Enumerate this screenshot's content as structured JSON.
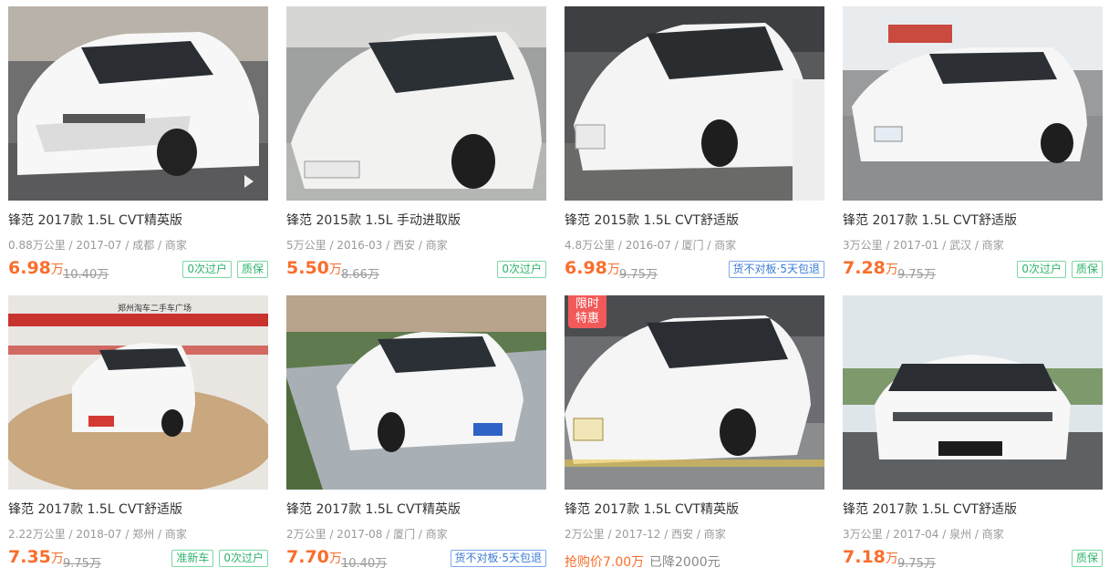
{
  "cards": [
    {
      "title": "锋范 2017款 1.5L CVT精英版",
      "meta": "0.88万公里 / 2017-07 / 成都 / 商家",
      "price": "6.98",
      "unit": "万",
      "orig": "10.40万",
      "tags": [
        "0次过户",
        "质保"
      ],
      "photo": {
        "bg": "#6f6f70",
        "floor": "#5a5a5c",
        "top": "#b9b2a8"
      }
    },
    {
      "title": "锋范 2015款 1.5L 手动进取版",
      "meta": "5万公里 / 2016-03 / 西安 / 商家",
      "price": "5.50",
      "unit": "万",
      "orig": "8.66万",
      "tags": [
        "0次过户"
      ],
      "photo": {
        "bg": "#9fa1a0",
        "floor": "#b4b6b4",
        "top": "#d6d6d2"
      }
    },
    {
      "title": "锋范 2015款 1.5L CVT舒适版",
      "meta": "4.8万公里 / 2016-07 / 厦门 / 商家",
      "price": "6.98",
      "unit": "万",
      "orig": "9.75万",
      "tags": [
        "货不对板·5天包退"
      ],
      "photo": {
        "bg": "#585a5c",
        "floor": "#6a6b68",
        "top": "#3d3f42"
      }
    },
    {
      "title": "锋范 2017款 1.5L CVT舒适版",
      "meta": "3万公里 / 2017-01 / 武汉 / 商家",
      "price": "7.28",
      "unit": "万",
      "orig": "9.75万",
      "tags": [
        "0次过户",
        "质保"
      ],
      "photo": {
        "bg": "#9a9b9c",
        "floor": "#8d8e90",
        "top": "#e8ecef"
      }
    },
    {
      "title": "锋范 2017款 1.5L CVT舒适版",
      "meta": "2.22万公里 / 2018-07 / 郑州 / 商家",
      "price": "7.35",
      "unit": "万",
      "orig": "9.75万",
      "tags": [
        "准新车",
        "0次过户"
      ],
      "photo": {
        "bg": "#e9e6e2",
        "floor": "#c9a77f",
        "top": "#f3f3f3"
      },
      "banner": "郑州淘车二手车广场"
    },
    {
      "title": "锋范 2017款 1.5L CVT精英版",
      "meta": "2万公里 / 2017-08 / 厦门 / 商家",
      "price": "7.70",
      "unit": "万",
      "orig": "10.40万",
      "tags": [
        "货不对板·5天包退"
      ],
      "photo": {
        "bg": "#5f7a4e",
        "floor": "#a9b0b5",
        "top": "#b9a38c"
      }
    },
    {
      "title": "锋范 2017款 1.5L CVT精英版",
      "meta": "2万公里 / 2017-12 / 西安 / 商家",
      "grab_label": "抢购价7.00万",
      "drop_label": "已降2000元",
      "badge": [
        "限时",
        "特惠"
      ],
      "photo": {
        "bg": "#6b6d70",
        "floor": "#8a8c8e",
        "top": "#4a4c50"
      }
    },
    {
      "title": "锋范 2017款 1.5L CVT舒适版",
      "meta": "3万公里 / 2017-04 / 泉州 / 商家",
      "price": "7.18",
      "unit": "万",
      "orig": "9.75万",
      "tags": [
        "质保"
      ],
      "photo": {
        "bg": "#dfe6ea",
        "floor": "#5e6163",
        "top": "#eef2f5"
      }
    }
  ],
  "colors": {
    "price": "#f96e2c",
    "green": "#2fb36c",
    "blue": "#3a7bd5",
    "orange": "#f59a2c",
    "badge": "#f25a5a"
  }
}
